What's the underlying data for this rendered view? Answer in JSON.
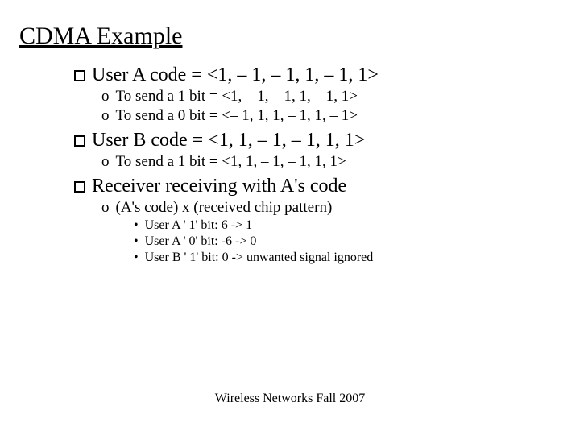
{
  "title": "CDMA Example",
  "items": {
    "userA": "User A code = <1, – 1, – 1, 1, – 1, 1>",
    "userA_send1": "To send a 1 bit = <1, – 1, – 1, 1, – 1, 1>",
    "userA_send0": "To send a 0 bit = <– 1, 1, 1, – 1, 1, – 1>",
    "userB": "User B code = <1, 1, – 1, – 1, 1, 1>",
    "userB_send1": "To send a 1 bit = <1, 1, – 1, – 1, 1, 1>",
    "receiver": "Receiver receiving with A's code",
    "recv_sub": "(A's code) x (received chip pattern)",
    "recv_a1": "User A ' 1' bit: 6 -> 1",
    "recv_a0": "User A ' 0' bit: -6 -> 0",
    "recv_b1": "User B ' 1' bit: 0 -> unwanted signal ignored"
  },
  "bullets": {
    "circle": "o",
    "dot": "•"
  },
  "footer": "Wireless Networks Fall 2007"
}
